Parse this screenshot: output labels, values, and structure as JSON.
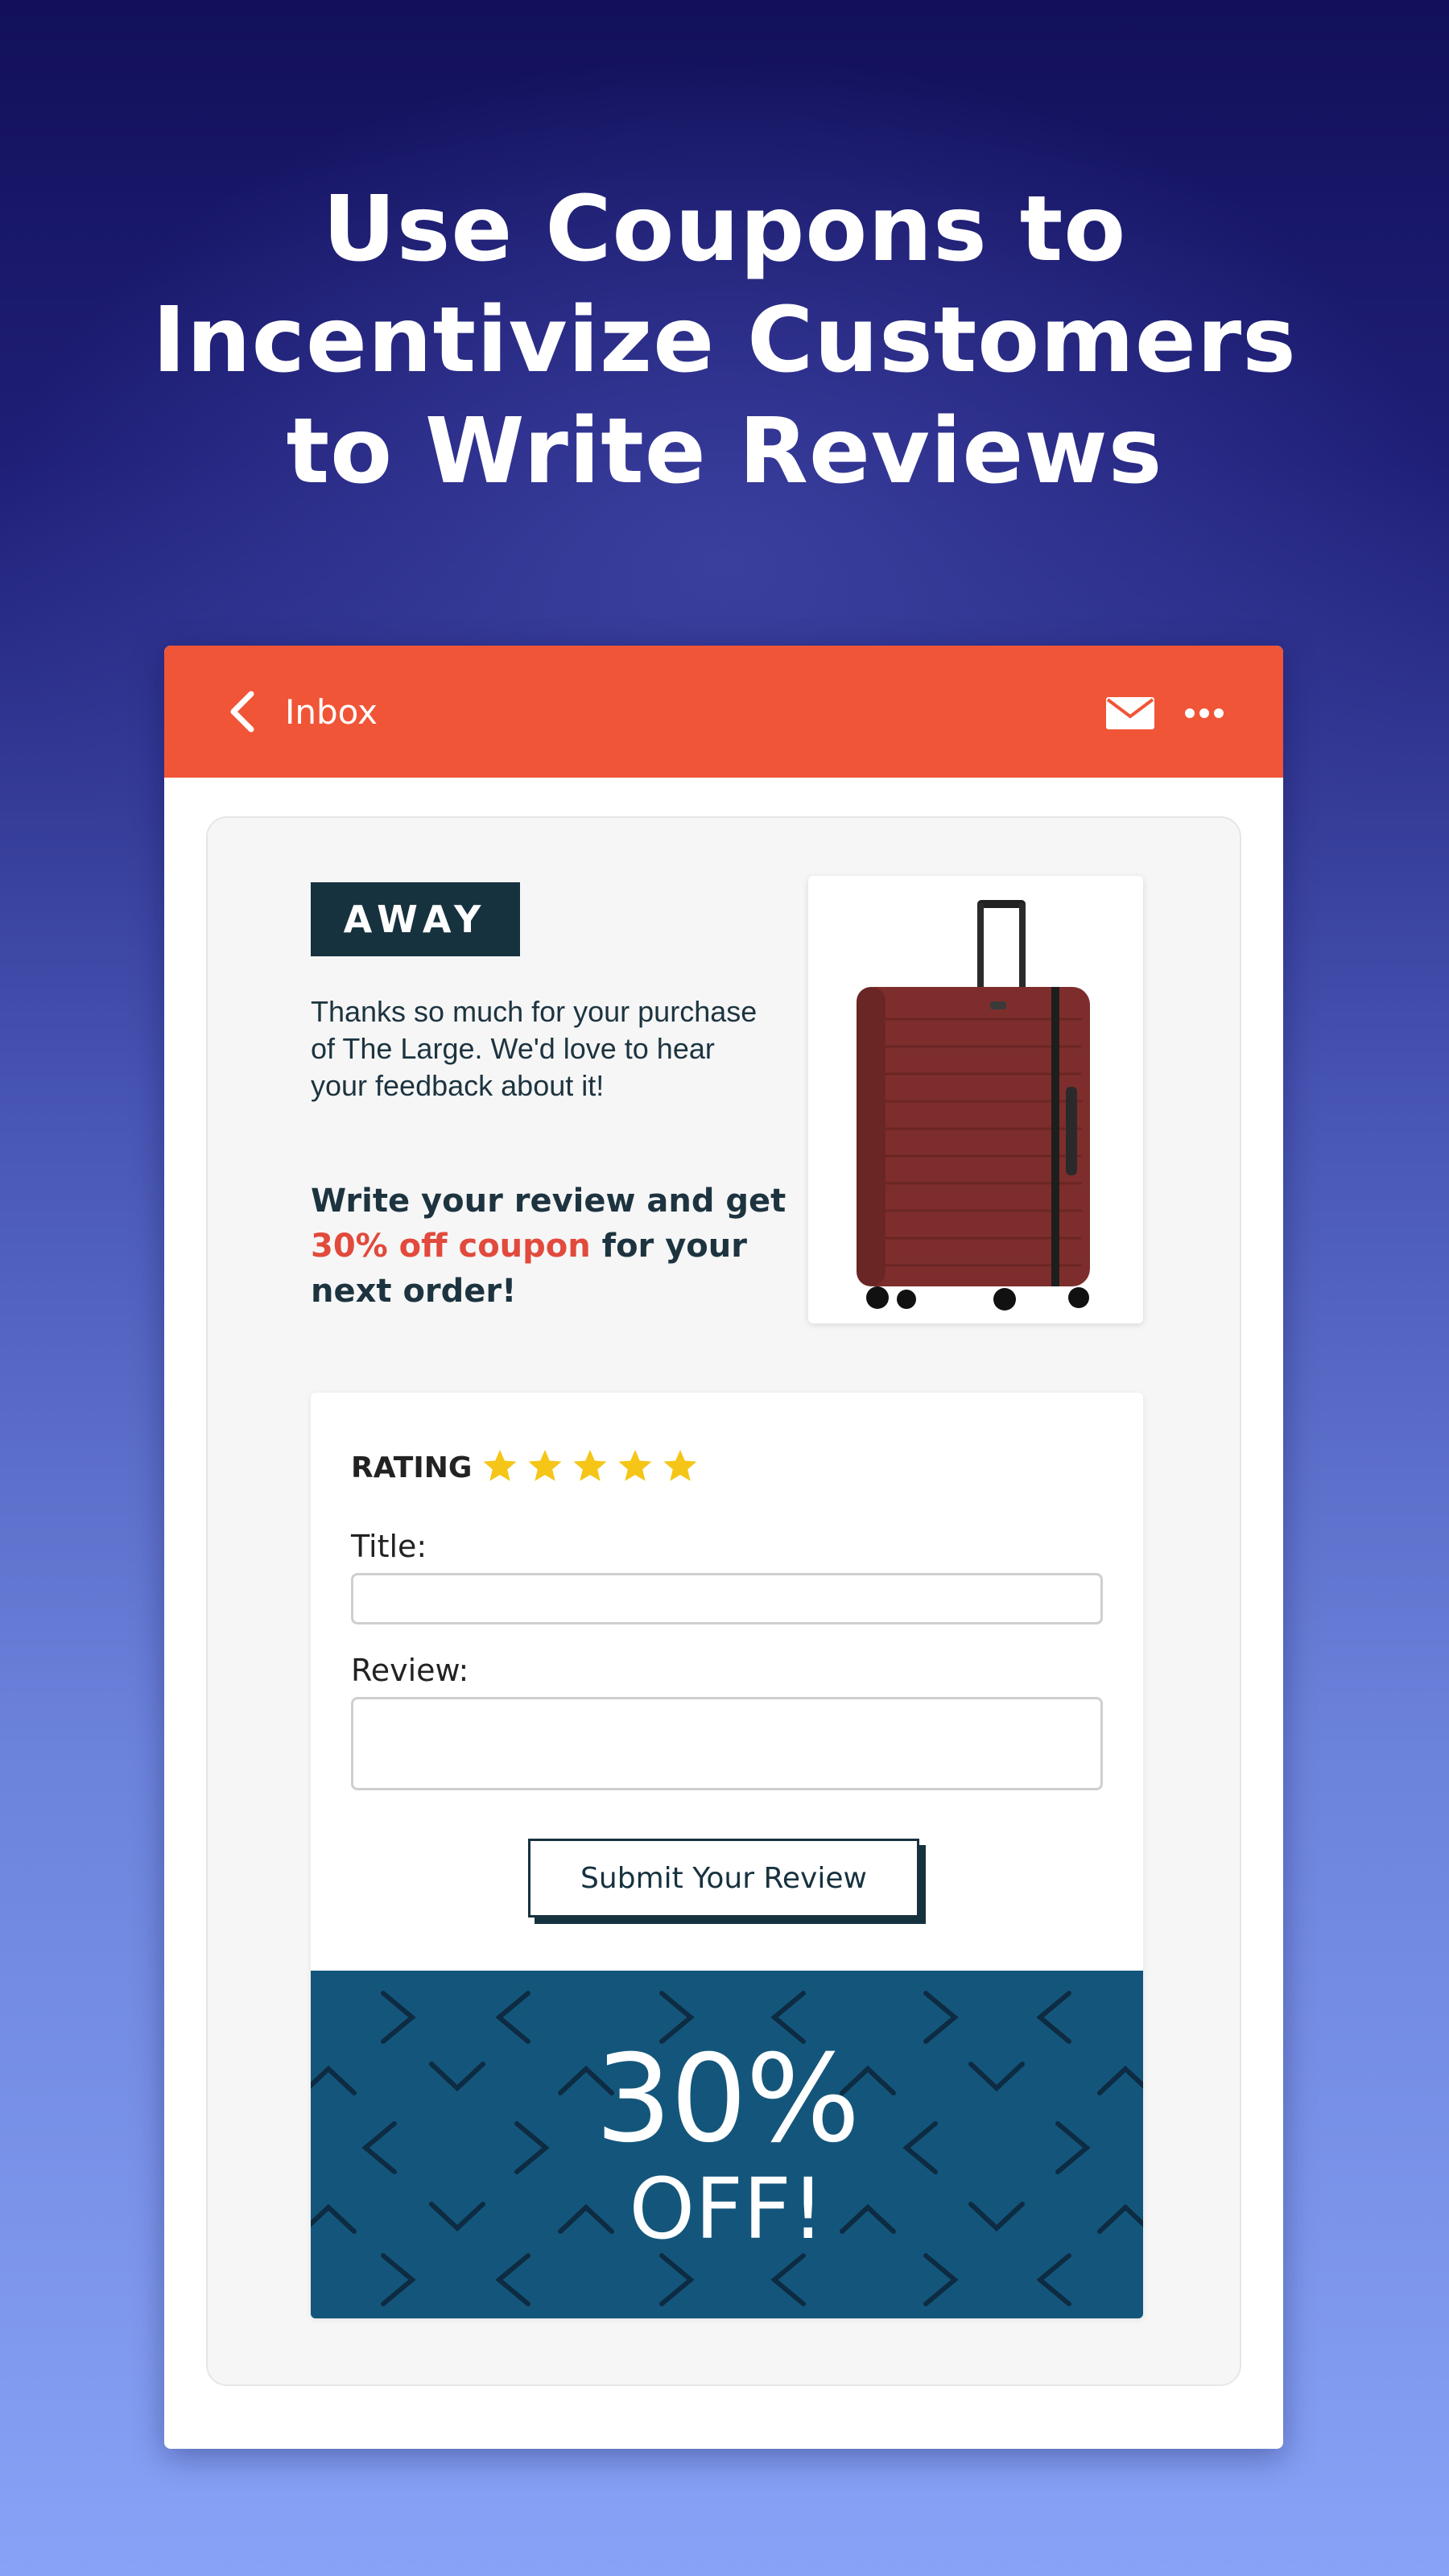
{
  "headline": [
    "Use Coupons to",
    "Incentivize Customers",
    "to Write Reviews"
  ],
  "topbar": {
    "back_icon": "chevron-left-icon",
    "inbox_label": "Inbox",
    "mail_icon": "envelope-icon",
    "more_icon": "ellipsis-icon",
    "color": "#f05537"
  },
  "email": {
    "brand_logo": "AWAY",
    "thanks_text": "Thanks so much for your purchase of The Large. We'd love to hear your feedback about it!",
    "offer_before": "Write your review and get ",
    "offer_highlight": "30% off coupon",
    "offer_after": " for your next order!",
    "product_image": "red-suitcase"
  },
  "form": {
    "rating_label": "RATING",
    "rating_value": 5,
    "rating_max": 5,
    "title_label": "Title:",
    "title_value": "",
    "review_label": "Review:",
    "review_value": "",
    "submit_label": "Submit Your Review"
  },
  "coupon": {
    "percent": "30%",
    "off": "OFF!",
    "background": "#14567b"
  },
  "colors": {
    "accent_red": "#e14a3c",
    "navy": "#17323f",
    "star": "#f5c518"
  }
}
